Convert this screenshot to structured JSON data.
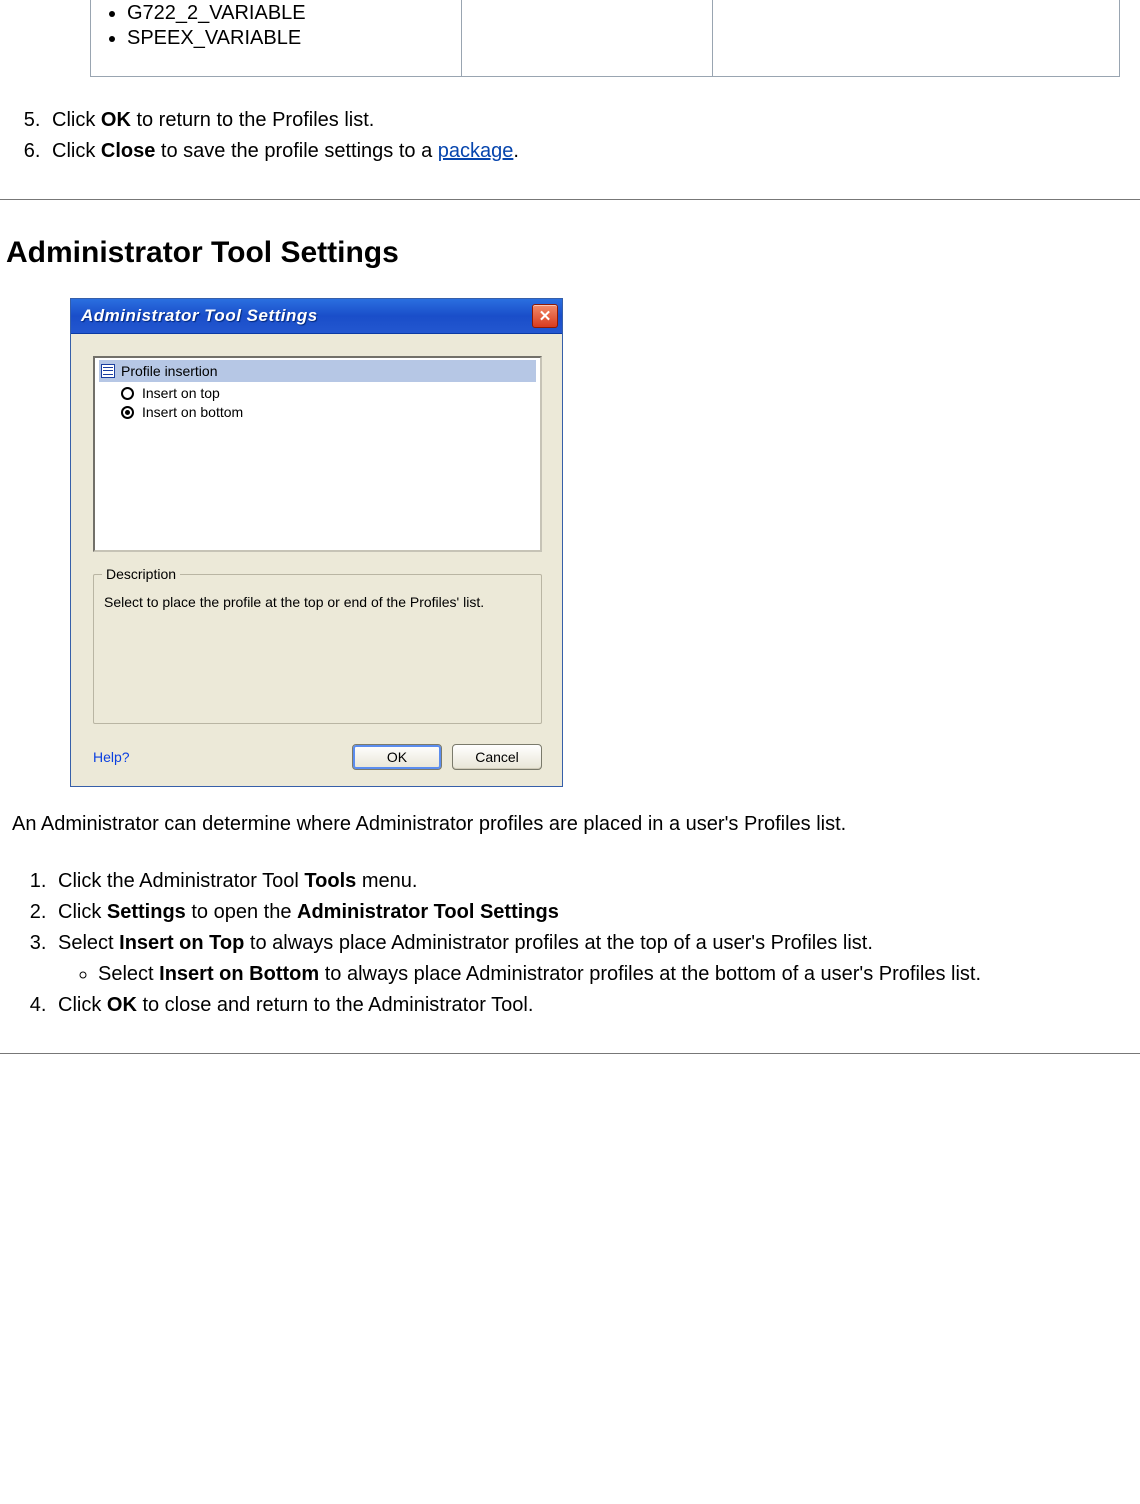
{
  "top_table": {
    "bullets": [
      "G722_2_VARIABLE",
      "SPEEX_VARIABLE"
    ]
  },
  "steps_top": [
    {
      "num": 5,
      "pre": "Click ",
      "bold": "OK",
      "post": " to return to the Profiles list."
    },
    {
      "num": 6,
      "pre": "Click ",
      "bold": "Close",
      "post": " to save the profile settings to a ",
      "link": "package",
      "post2": "."
    }
  ],
  "section_title": "Administrator Tool Settings",
  "dialog": {
    "title": "Administrator Tool Settings",
    "heading": "Profile insertion",
    "opt_top": "Insert on top",
    "opt_bottom": "Insert on bottom",
    "group_legend": "Description",
    "description": "Select to place the profile at the top or end of the Profiles' list.",
    "help": "Help?",
    "ok": "OK",
    "cancel": "Cancel"
  },
  "paragraph": "An Administrator can determine where Administrator profiles are placed in a user's Profiles list.",
  "steps_bottom": {
    "s1_pre": "Click the Administrator Tool ",
    "s1_b": "Tools",
    "s1_post": " menu.",
    "s2_pre": "Click ",
    "s2_b": "Settings",
    "s2_mid": " to open the ",
    "s2_b2": "Administrator Tool Settings",
    "s3_pre": "Select ",
    "s3_b": "Insert on Top",
    "s3_post": " to always place Administrator profiles at the top of a user's Profiles list.",
    "s3a_pre": "Select ",
    "s3a_b": "Insert on Bottom",
    "s3a_post": " to always place Administrator profiles at the bottom of a user's Profiles list.",
    "s4_pre": "Click ",
    "s4_b": "OK",
    "s4_post": " to close and return to the Administrator Tool."
  }
}
